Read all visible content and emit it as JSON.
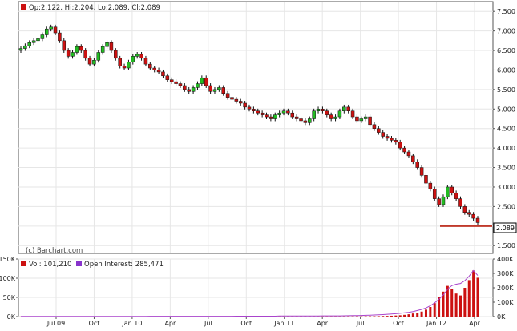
{
  "header": {
    "ohlc_text": "Op:2.122, Hi:2.204, Lo:2.089, Cl:2.089"
  },
  "watermark": "(c) Barchart.com",
  "last_price_label": "2.089",
  "volume_legend": {
    "vol_text": "Vol: 101,210",
    "oi_text": "Open Interest: 285,471"
  },
  "colors": {
    "up": "#22bb22",
    "down": "#cc1111",
    "vol": "#cc1111",
    "oi": "#aa44cc",
    "support": "#c0392b",
    "grid": "#e6e6e6",
    "ohlc_marker": "#cc1111",
    "vol_marker": "#cc1111",
    "oi_marker": "#8833cc"
  },
  "chart_data": [
    {
      "type": "candlestick",
      "y_axis_side": "right",
      "ylim": [
        1.3,
        7.75
      ],
      "yticks": [
        "1.500",
        "2.000",
        "2.500",
        "3.000",
        "3.500",
        "4.000",
        "4.500",
        "5.000",
        "5.500",
        "6.000",
        "6.500",
        "7.000",
        "7.500"
      ],
      "xticks": [
        "Jul 09",
        "Oct",
        "Jan 10",
        "Apr",
        "Jul",
        "Oct",
        "Jan 11",
        "Apr",
        "Jul",
        "Oct",
        "Jan 12",
        "Apr"
      ],
      "grid": true,
      "closes": [
        6.55,
        6.62,
        6.7,
        6.75,
        6.8,
        6.9,
        7.05,
        7.1,
        6.95,
        6.75,
        6.5,
        6.35,
        6.45,
        6.6,
        6.5,
        6.3,
        6.15,
        6.25,
        6.45,
        6.6,
        6.7,
        6.5,
        6.3,
        6.1,
        6.05,
        6.2,
        6.35,
        6.4,
        6.3,
        6.15,
        6.05,
        6.0,
        5.95,
        5.85,
        5.75,
        5.7,
        5.65,
        5.6,
        5.5,
        5.45,
        5.55,
        5.65,
        5.8,
        5.6,
        5.45,
        5.5,
        5.55,
        5.4,
        5.3,
        5.25,
        5.2,
        5.15,
        5.05,
        5.0,
        4.95,
        4.9,
        4.85,
        4.8,
        4.75,
        4.85,
        4.9,
        4.95,
        4.9,
        4.8,
        4.75,
        4.7,
        4.65,
        4.75,
        4.95,
        5.0,
        4.95,
        4.85,
        4.75,
        4.8,
        4.95,
        5.05,
        4.95,
        4.8,
        4.7,
        4.75,
        4.8,
        4.6,
        4.5,
        4.4,
        4.3,
        4.25,
        4.2,
        4.15,
        4.0,
        3.9,
        3.8,
        3.65,
        3.5,
        3.3,
        3.1,
        2.95,
        2.7,
        2.55,
        2.75,
        3.0,
        2.85,
        2.7,
        2.5,
        2.35,
        2.3,
        2.2,
        2.089
      ],
      "support_level": 2.0
    },
    {
      "type": "bar+line",
      "left_axis": {
        "label": "Vol",
        "yticks": [
          "0K",
          "50K",
          "100K",
          "150K"
        ],
        "ylim": [
          0,
          150000
        ],
        "values": [
          200,
          200,
          200,
          200,
          200,
          200,
          200,
          200,
          200,
          200,
          200,
          200,
          200,
          200,
          200,
          200,
          200,
          200,
          200,
          200,
          200,
          200,
          200,
          200,
          200,
          200,
          200,
          200,
          200,
          200,
          200,
          200,
          200,
          200,
          200,
          200,
          200,
          200,
          200,
          200,
          300,
          300,
          300,
          300,
          300,
          300,
          300,
          300,
          300,
          300,
          300,
          300,
          300,
          300,
          300,
          300,
          300,
          300,
          300,
          300,
          400,
          400,
          400,
          400,
          400,
          400,
          400,
          400,
          400,
          400,
          500,
          500,
          500,
          500,
          500,
          500,
          600,
          600,
          700,
          700,
          800,
          900,
          1000,
          1200,
          1500,
          1800,
          2200,
          2800,
          3500,
          4500,
          6000,
          8000,
          10000,
          13000,
          18000,
          25000,
          35000,
          50000,
          65000,
          80000,
          72000,
          60000,
          55000,
          75000,
          95000,
          120000,
          101210
        ]
      },
      "right_axis": {
        "label": "Open Interest",
        "yticks": [
          "0K",
          "100K",
          "200K",
          "300K",
          "400K"
        ],
        "ylim": [
          0,
          400000
        ],
        "values": [
          1000,
          1000,
          1000,
          1000,
          1000,
          1000,
          1000,
          1000,
          1000,
          1000,
          1000,
          1000,
          1000,
          1000,
          1000,
          1000,
          1000,
          1000,
          1000,
          1000,
          1500,
          1500,
          1500,
          1500,
          1500,
          1500,
          1500,
          1500,
          1500,
          1500,
          2000,
          2000,
          2000,
          2000,
          2000,
          2000,
          2000,
          2000,
          2000,
          2000,
          2500,
          2500,
          2500,
          2500,
          2500,
          2500,
          2500,
          2500,
          2500,
          2500,
          3000,
          3000,
          3000,
          3000,
          3000,
          3000,
          3000,
          3000,
          3000,
          3000,
          4000,
          4000,
          4000,
          4000,
          4000,
          4000,
          4000,
          4000,
          4000,
          4000,
          5000,
          5000,
          5000,
          5000,
          5000,
          5500,
          6000,
          6500,
          7000,
          8000,
          9000,
          10000,
          11000,
          12000,
          14000,
          16000,
          18000,
          20000,
          23000,
          26000,
          30000,
          35000,
          42000,
          50000,
          60000,
          75000,
          95000,
          120000,
          150000,
          190000,
          215000,
          225000,
          230000,
          250000,
          280000,
          320000,
          285471
        ]
      }
    }
  ]
}
